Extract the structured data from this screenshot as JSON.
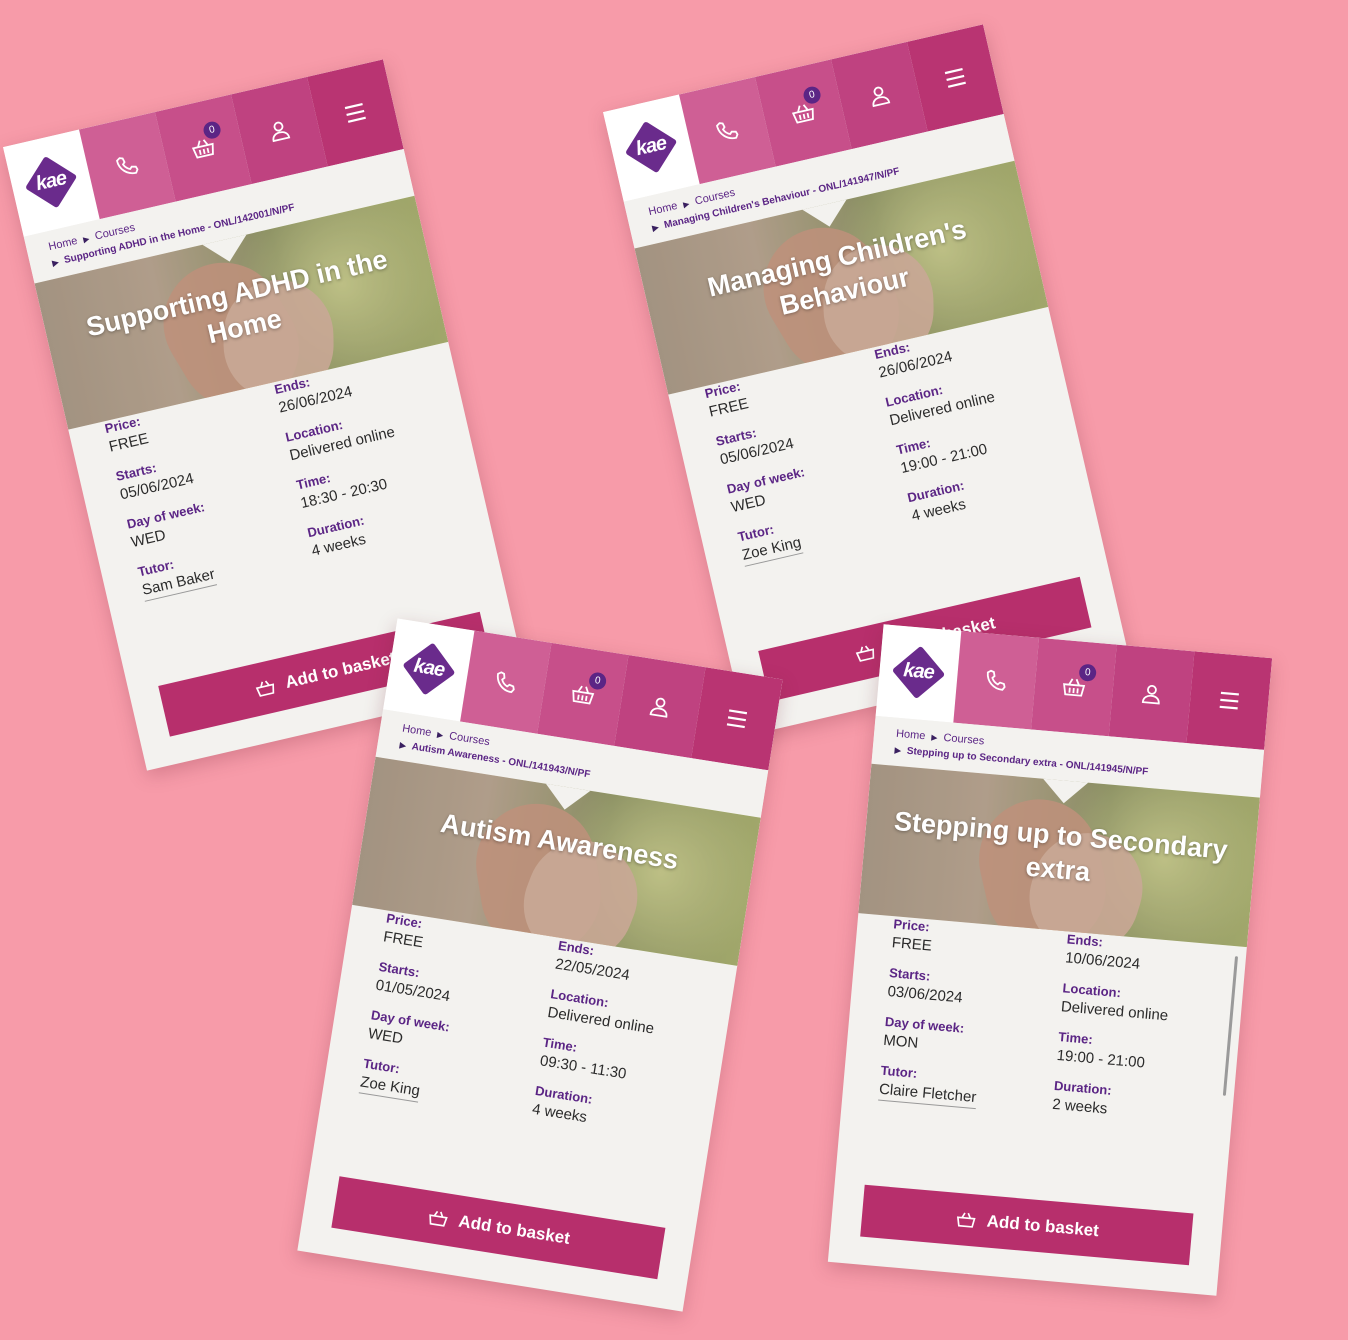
{
  "logo_text": "kae",
  "header": {
    "basket_count": "0"
  },
  "breadcrumb": {
    "home": "Home",
    "courses": "Courses"
  },
  "labels": {
    "price": "Price:",
    "starts": "Starts:",
    "day": "Day of week:",
    "tutor": "Tutor:",
    "ends": "Ends:",
    "location": "Location:",
    "time": "Time:",
    "duration": "Duration:"
  },
  "add_to_basket": "Add to basket",
  "courses": [
    {
      "crumb": "Supporting ADHD in the Home - ONL/142001/N/PF",
      "title": "Supporting ADHD in the Home",
      "price": "FREE",
      "starts": "05/06/2024",
      "day": "WED",
      "tutor": "Sam Baker",
      "ends": "26/06/2024",
      "location": "Delivered online",
      "time": "18:30 - 20:30",
      "duration": "4 weeks"
    },
    {
      "crumb": "Managing Children's Behaviour - ONL/141947/N/PF",
      "title": "Managing Children's Behaviour",
      "price": "FREE",
      "starts": "05/06/2024",
      "day": "WED",
      "tutor": "Zoe King",
      "ends": "26/06/2024",
      "location": "Delivered online",
      "time": "19:00 - 21:00",
      "duration": "4 weeks"
    },
    {
      "crumb": "Autism Awareness - ONL/141943/N/PF",
      "title": "Autism Awareness",
      "price": "FREE",
      "starts": "01/05/2024",
      "day": "WED",
      "tutor": "Zoe King",
      "ends": "22/05/2024",
      "location": "Delivered online",
      "time": "09:30 - 11:30",
      "duration": "4 weeks"
    },
    {
      "crumb": "Stepping up to Secondary extra - ONL/141945/N/PF",
      "title": "Stepping up to Secondary extra",
      "price": "FREE",
      "starts": "03/06/2024",
      "day": "MON",
      "tutor": "Claire Fletcher",
      "ends": "10/06/2024",
      "location": "Delivered online",
      "time": "19:00 - 21:00",
      "duration": "2 weeks"
    }
  ],
  "colors": {
    "background": "#f79ba9",
    "brand_purple": "#5b2585",
    "brand_pink": "#b72f6c"
  },
  "icons": [
    "kae-logo",
    "phone-icon",
    "basket-icon",
    "user-icon",
    "menu-icon"
  ]
}
